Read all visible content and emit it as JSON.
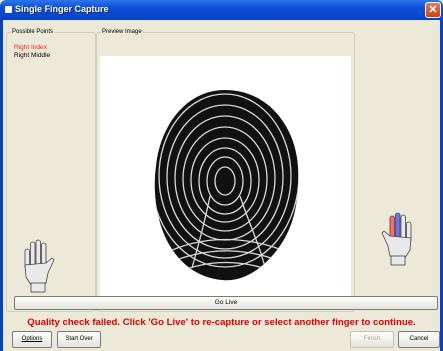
{
  "window": {
    "title": "Single Finger Capture",
    "close_glyph": "✕"
  },
  "possible_points": {
    "legend": "Possible Points",
    "items": [
      {
        "label": "Right Index",
        "selected": true
      },
      {
        "label": "Right Middle",
        "selected": false
      }
    ]
  },
  "preview": {
    "legend": "Preview Image"
  },
  "hands": {
    "left": "left-hand-icon",
    "right": "right-hand-icon",
    "highlight_colors": [
      "#ff6060",
      "#6060ff"
    ]
  },
  "go_live_label": "Go Live",
  "status_message": "Quality check failed.  Click 'Go Live' to re-capture or select another finger to continue.",
  "buttons": {
    "options_label": "Options",
    "options_underline": "O",
    "start_over_label": "Start Over",
    "finish_label": "Finish",
    "cancel_label": "Cancel"
  }
}
